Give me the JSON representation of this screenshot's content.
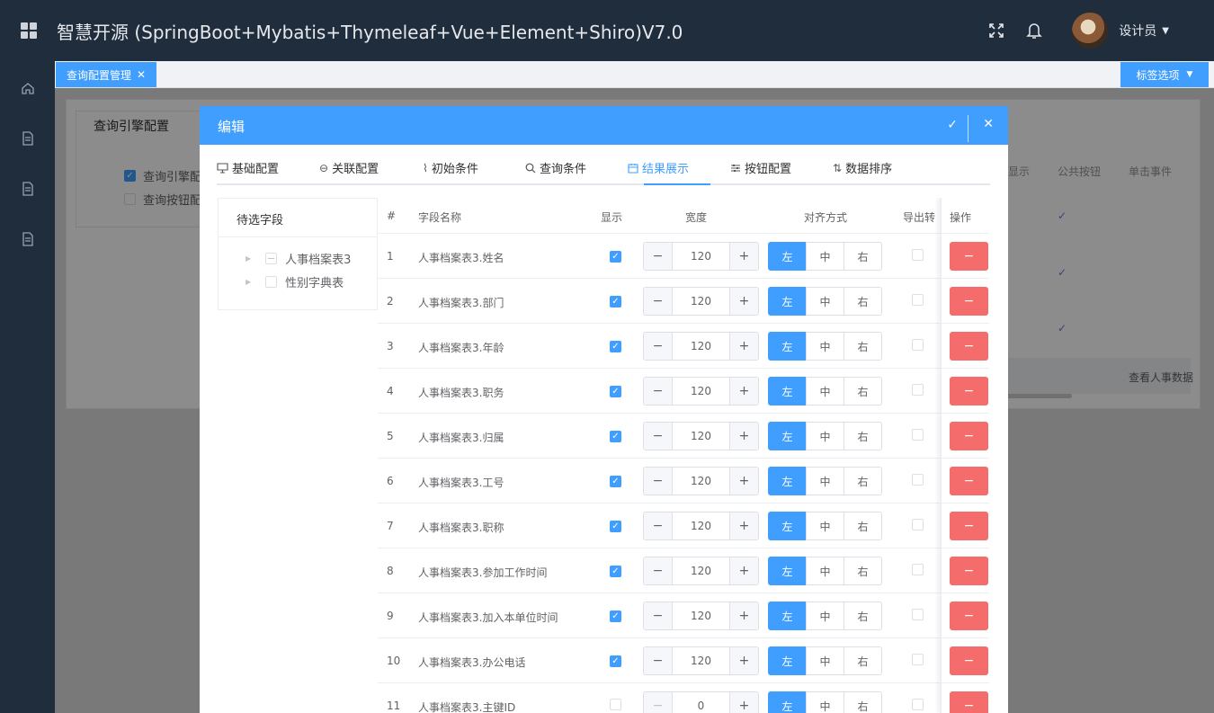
{
  "header": {
    "title": "智慧开源 (SpringBoot+Mybatis+Thymeleaf+Vue+Element+Shiro)V7.0",
    "user_name": "设计员"
  },
  "tabs_bar": {
    "active_tab": "查询配置管理",
    "options_label": "标签选项"
  },
  "background": {
    "panel_title": "查询引擎配置",
    "checkbox_1": "查询引擎配",
    "checkbox_2": "查询按钮配",
    "col_show": "显示",
    "col_public_btn": "公共按钮",
    "col_click_event": "单击事件",
    "link_text": "查看人事数据"
  },
  "dialog": {
    "title": "编辑",
    "tabs": [
      {
        "label": "基础配置",
        "icon": "monitor-icon"
      },
      {
        "label": "关联配置",
        "icon": "link-icon"
      },
      {
        "label": "初始条件",
        "icon": "paperclip-icon"
      },
      {
        "label": "查询条件",
        "icon": "search-icon"
      },
      {
        "label": "结果展示",
        "icon": "calendar-icon"
      },
      {
        "label": "按钮配置",
        "icon": "sliders-icon"
      },
      {
        "label": "数据排序",
        "icon": "sort-icon"
      }
    ],
    "active_tab": "结果展示",
    "tree": {
      "title": "待选字段",
      "nodes": [
        "人事档案表3",
        "性别字典表"
      ]
    },
    "table": {
      "headers": {
        "idx": "#",
        "name": "字段名称",
        "show": "显示",
        "width": "宽度",
        "align": "对齐方式",
        "export": "导出转",
        "op": "操作"
      },
      "align_labels": [
        "左",
        "中",
        "右"
      ],
      "rows": [
        {
          "idx": "1",
          "name": "人事档案表3.姓名",
          "show": true,
          "width": "120"
        },
        {
          "idx": "2",
          "name": "人事档案表3.部门",
          "show": true,
          "width": "120"
        },
        {
          "idx": "3",
          "name": "人事档案表3.年龄",
          "show": true,
          "width": "120"
        },
        {
          "idx": "4",
          "name": "人事档案表3.职务",
          "show": true,
          "width": "120"
        },
        {
          "idx": "5",
          "name": "人事档案表3.归属",
          "show": true,
          "width": "120"
        },
        {
          "idx": "6",
          "name": "人事档案表3.工号",
          "show": true,
          "width": "120"
        },
        {
          "idx": "7",
          "name": "人事档案表3.职称",
          "show": true,
          "width": "120"
        },
        {
          "idx": "8",
          "name": "人事档案表3.参加工作时间",
          "show": true,
          "width": "120"
        },
        {
          "idx": "9",
          "name": "人事档案表3.加入本单位时间",
          "show": true,
          "width": "120"
        },
        {
          "idx": "10",
          "name": "人事档案表3.办公电话",
          "show": true,
          "width": "120"
        },
        {
          "idx": "11",
          "name": "人事档案表3.主键ID",
          "show": false,
          "width": "0"
        }
      ]
    }
  },
  "colors": {
    "primary": "#409eff",
    "danger": "#f56c6c",
    "header_bg": "#1f2d3d"
  }
}
